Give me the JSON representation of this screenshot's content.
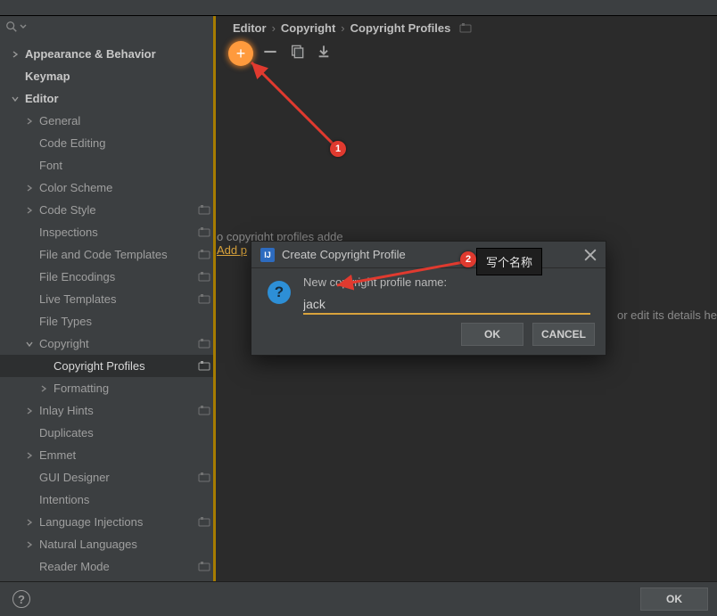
{
  "breadcrumb": {
    "a": "Editor",
    "b": "Copyright",
    "c": "Copyright Profiles"
  },
  "sidebar": {
    "appearance": "Appearance & Behavior",
    "keymap": "Keymap",
    "editor": "Editor",
    "general": "General",
    "code_editing": "Code Editing",
    "font": "Font",
    "color_scheme": "Color Scheme",
    "code_style": "Code Style",
    "inspections": "Inspections",
    "file_code_templates": "File and Code Templates",
    "file_encodings": "File Encodings",
    "live_templates": "Live Templates",
    "file_types": "File Types",
    "copyright": "Copyright",
    "copyright_profiles": "Copyright Profiles",
    "formatting": "Formatting",
    "inlay_hints": "Inlay Hints",
    "duplicates": "Duplicates",
    "emmet": "Emmet",
    "gui_designer": "GUI Designer",
    "intentions": "Intentions",
    "language_injections": "Language Injections",
    "natural_languages": "Natural Languages",
    "reader_mode": "Reader Mode"
  },
  "empty": {
    "msg": "o copyright profiles adde",
    "link": "Add p"
  },
  "hint_right": "or edit its details he",
  "dialog": {
    "title": "Create Copyright Profile",
    "label": "New copyright profile name:",
    "value": "jack",
    "ok": "OK",
    "cancel": "CANCEL"
  },
  "footer": {
    "ok": "OK"
  },
  "anno": {
    "b1": "1",
    "b2": "2",
    "label": "写个名称"
  }
}
